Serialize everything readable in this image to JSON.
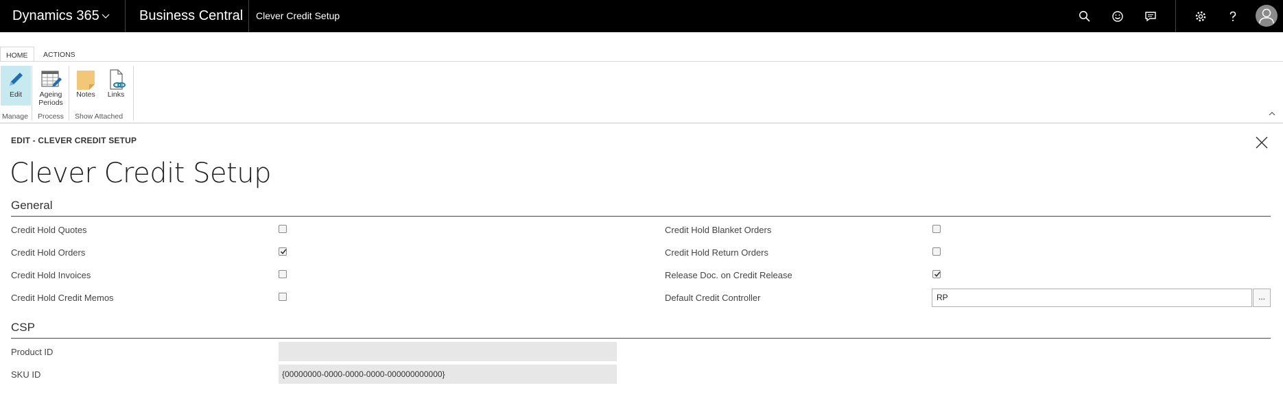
{
  "topbar": {
    "brand": "Dynamics 365",
    "app": "Business Central",
    "page": "Clever Credit Setup",
    "icons": [
      "search-icon",
      "smiley-icon",
      "chat-icon",
      "gear-icon",
      "help-icon",
      "user-icon"
    ]
  },
  "ribbon": {
    "tabs": [
      "HOME",
      "ACTIONS"
    ],
    "buttons": {
      "edit": "Edit",
      "ageing_line1": "Ageing",
      "ageing_line2": "Periods",
      "notes": "Notes",
      "links": "Links"
    },
    "groups": {
      "manage": "Manage",
      "process": "Process",
      "show_attached": "Show Attached"
    }
  },
  "page": {
    "breadcrumb": "EDIT - CLEVER CREDIT SETUP",
    "title": "Clever Credit Setup"
  },
  "general": {
    "heading": "General",
    "left": [
      {
        "label": "Credit Hold Quotes",
        "checked": false
      },
      {
        "label": "Credit Hold Orders",
        "checked": true
      },
      {
        "label": "Credit Hold Invoices",
        "checked": false
      },
      {
        "label": "Credit Hold Credit Memos",
        "checked": false
      }
    ],
    "right": [
      {
        "label": "Credit Hold Blanket Orders",
        "checked": false
      },
      {
        "label": "Credit Hold Return Orders",
        "checked": false
      },
      {
        "label": "Release Doc. on Credit Release",
        "checked": true
      }
    ],
    "default_controller": {
      "label": "Default Credit Controller",
      "value": "RP",
      "lookup": "..."
    }
  },
  "csp": {
    "heading": "CSP",
    "product_id": {
      "label": "Product ID",
      "value": ""
    },
    "sku_id": {
      "label": "SKU ID",
      "value": "{00000000-0000-0000-0000-000000000000}"
    }
  }
}
